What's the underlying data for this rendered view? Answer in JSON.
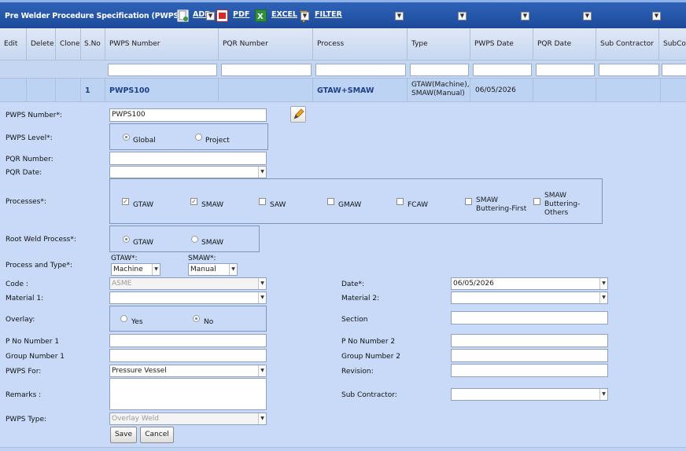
{
  "toolbar": {
    "title": "Pre Welder Procedure Specification (PWPS)",
    "add": "ADD",
    "pdf": "PDF",
    "excel": "EXCEL",
    "filter": "FILTER"
  },
  "columns": [
    "Edit",
    "Delete",
    "Clone",
    "S.No",
    "PWPS Number",
    "PQR Number",
    "Process",
    "Type",
    "PWPS Date",
    "PQR Date",
    "Sub Contractor",
    "SubCo"
  ],
  "row": {
    "sno": "1",
    "pwps_number": "PWPS100",
    "process": "GTAW+SMAW",
    "type": "GTAW(Machine), SMAW(Manual)",
    "pwps_date": "06/05/2026"
  },
  "form": {
    "pwps_number_label": "PWPS Number*:",
    "pwps_number_value": "PWPS100",
    "pwps_level_label": "PWPS Level*:",
    "level_global": "Global",
    "level_project": "Project",
    "level_selected": "Global",
    "pqr_number_label": "PQR Number:",
    "pqr_date_label": "PQR Date:",
    "processes_label": "Processes*:",
    "processes": [
      {
        "label": "GTAW",
        "checked": true
      },
      {
        "label": "SMAW",
        "checked": true
      },
      {
        "label": "SAW",
        "checked": false
      },
      {
        "label": "GMAW",
        "checked": false
      },
      {
        "label": "FCAW",
        "checked": false
      },
      {
        "label": "SMAW Buttering-First",
        "checked": false
      },
      {
        "label": "SMAW Buttering-Others",
        "checked": false
      }
    ],
    "root_weld_label": "Root Weld Process*:",
    "root_gtaw": "GTAW",
    "root_smaw": "SMAW",
    "root_selected": "GTAW",
    "process_type_label": "Process and Type*:",
    "gtaw_type_label": "GTAW*:",
    "gtaw_type_value": "Machine",
    "smaw_type_label": "SMAW*:",
    "smaw_type_value": "Manual",
    "code_label": "Code :",
    "code_value": "ASME",
    "date_label": "Date*:",
    "date_value": "06/05/2026",
    "material1_label": "Material 1:",
    "material2_label": "Material 2:",
    "overlay_label": "Overlay:",
    "overlay_yes": "Yes",
    "overlay_no": "No",
    "overlay_selected": "No",
    "section_label": "Section",
    "pno1_label": "P No Number 1",
    "pno2_label": "P No Number 2",
    "group1_label": "Group Number 1",
    "group2_label": "Group Number 2",
    "pwps_for_label": "PWPS For:",
    "pwps_for_value": "Pressure Vessel",
    "revision_label": "Revision:",
    "remarks_label": "Remarks :",
    "subcontractor_label": "Sub Contractor:",
    "pwps_type_label": "PWPS Type:",
    "pwps_type_value": "Overlay Weld",
    "save": "Save",
    "cancel": "Cancel"
  },
  "colors": {
    "toolbar_bg": "#1c4a9a",
    "page_bg": "#c8daf7",
    "row_text": "#1d3f86"
  }
}
